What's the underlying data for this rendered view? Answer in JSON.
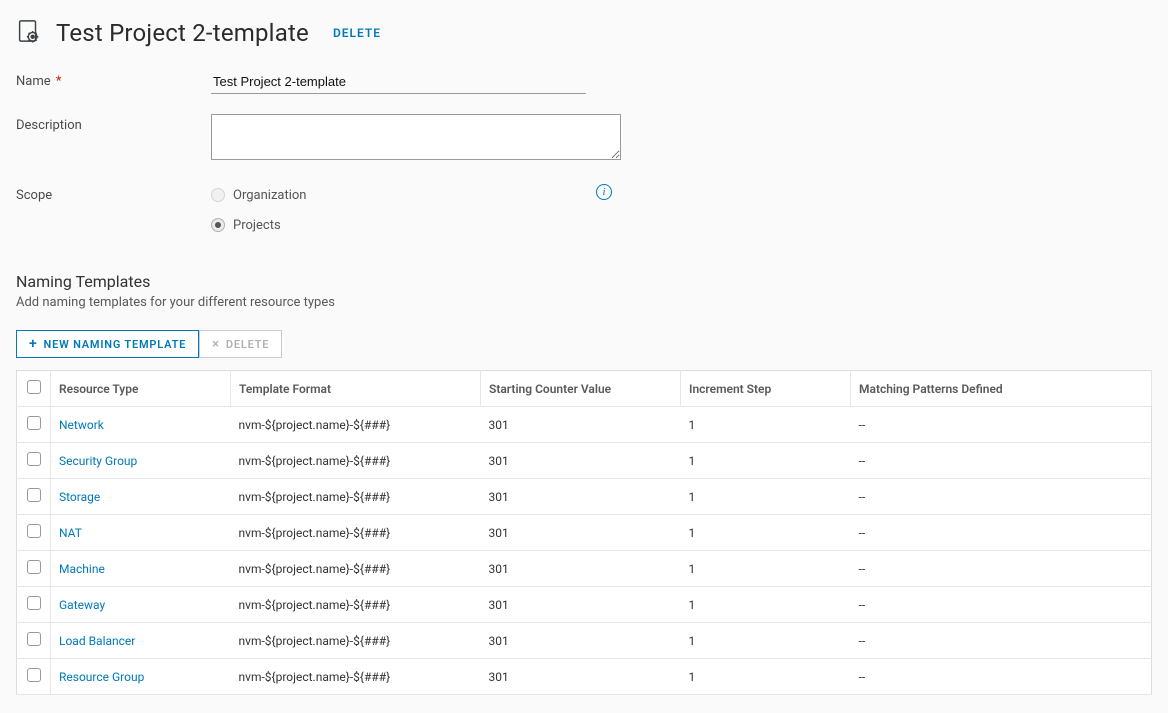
{
  "header": {
    "title": "Test Project 2-template",
    "delete_label": "DELETE"
  },
  "form": {
    "name_label": "Name",
    "required_marker": "*",
    "name_value": "Test Project 2-template",
    "description_label": "Description",
    "description_value": "",
    "scope_label": "Scope",
    "scope_organization_label": "Organization",
    "scope_projects_label": "Projects",
    "scope_selected": "projects"
  },
  "section": {
    "title": "Naming Templates",
    "desc": "Add naming templates for your different resource types"
  },
  "toolbar": {
    "new_label": "NEW NAMING TEMPLATE",
    "delete_label": "DELETE",
    "plus_glyph": "+",
    "x_glyph": "×"
  },
  "table": {
    "columns": {
      "resource_type": "Resource Type",
      "template_format": "Template Format",
      "starting_counter": "Starting Counter Value",
      "increment_step": "Increment Step",
      "matching_patterns": "Matching Patterns Defined"
    },
    "rows": [
      {
        "resource_type": "Network",
        "template_format": "nvm-${project.name}-${###}",
        "starting_counter": "301",
        "increment_step": "1",
        "matching_patterns": "--"
      },
      {
        "resource_type": "Security Group",
        "template_format": "nvm-${project.name}-${###}",
        "starting_counter": "301",
        "increment_step": "1",
        "matching_patterns": "--"
      },
      {
        "resource_type": "Storage",
        "template_format": "nvm-${project.name}-${###}",
        "starting_counter": "301",
        "increment_step": "1",
        "matching_patterns": "--"
      },
      {
        "resource_type": "NAT",
        "template_format": "nvm-${project.name}-${###}",
        "starting_counter": "301",
        "increment_step": "1",
        "matching_patterns": "--"
      },
      {
        "resource_type": "Machine",
        "template_format": "nvm-${project.name}-${###}",
        "starting_counter": "301",
        "increment_step": "1",
        "matching_patterns": "--"
      },
      {
        "resource_type": "Gateway",
        "template_format": "nvm-${project.name}-${###}",
        "starting_counter": "301",
        "increment_step": "1",
        "matching_patterns": "--"
      },
      {
        "resource_type": "Load Balancer",
        "template_format": "nvm-${project.name}-${###}",
        "starting_counter": "301",
        "increment_step": "1",
        "matching_patterns": "--"
      },
      {
        "resource_type": "Resource Group",
        "template_format": "nvm-${project.name}-${###}",
        "starting_counter": "301",
        "increment_step": "1",
        "matching_patterns": "--"
      }
    ]
  },
  "info_glyph": "i"
}
